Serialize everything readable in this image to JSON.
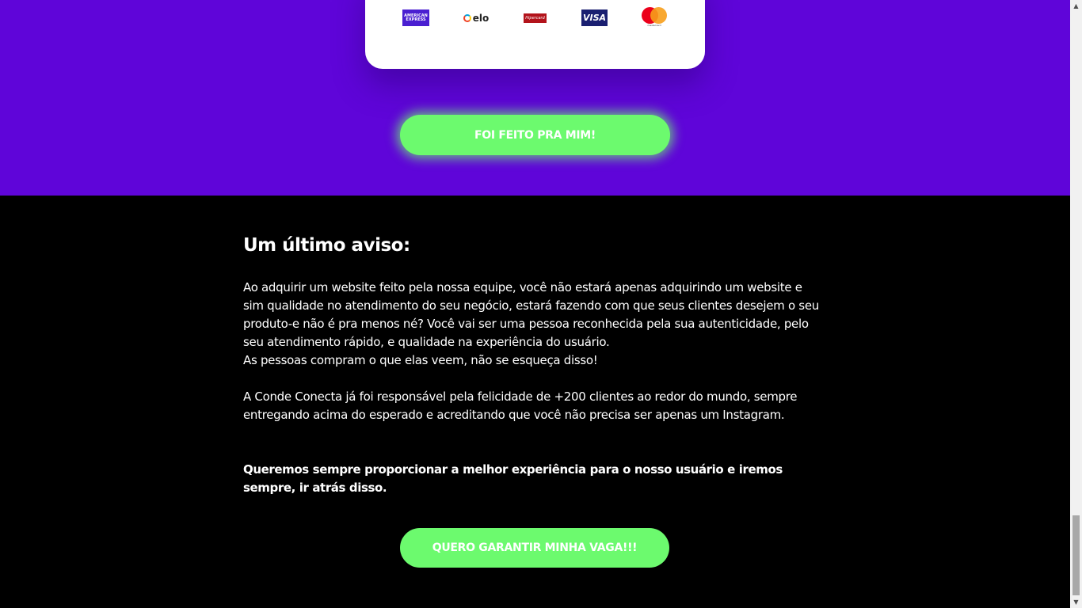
{
  "payment_card": {
    "brands": [
      {
        "name": "American Express",
        "text": "AMERICAN EXPRESS",
        "icon": "amex-icon",
        "color": "#4a1fd1"
      },
      {
        "name": "Elo",
        "text": "elo",
        "icon": "elo-icon"
      },
      {
        "name": "Hipercard",
        "text": "Hipercard",
        "icon": "hipercard-icon",
        "color": "#b3131b"
      },
      {
        "name": "Visa",
        "text": "VISA",
        "icon": "visa-icon",
        "color": "#1a1f71"
      },
      {
        "name": "Mastercard",
        "text": "mastercard",
        "icon": "mastercard-icon"
      }
    ]
  },
  "cta_top": {
    "label": "FOI FEITO PRA MIM!"
  },
  "notice": {
    "title": "Um último aviso:",
    "paragraph1": "Ao adquirir um website feito pela nossa equipe, você não estará apenas adquirindo um website e sim qualidade no atendimento do seu negócio, estará fazendo com que seus clientes desejem o seu produto-e não é pra menos né? Você vai ser uma pessoa reconhecida pela sua autenticidade, pelo seu atendimento rápido, e qualidade na experiência do usuário.",
    "paragraph2": "As pessoas compram o que elas veem, não se esqueça disso!",
    "paragraph3": "A Conde Conecta já foi responsável pela felicidade de +200 clientes ao redor do mundo, sempre entregando acima do esperado e acreditando que você não precisa ser apenas um Instagram.",
    "strong": "Queremos sempre proporcionar a melhor experiência para o nosso usuário e iremos sempre, ir atrás disso."
  },
  "cta_bottom": {
    "label": "QUERO GARANTIR MINHA VAGA!!!"
  },
  "colors": {
    "purple": "#5f05d9",
    "green": "#6cfa6e",
    "background": "#000000",
    "text": "#ffffff"
  },
  "scrollbar": {
    "icons": [
      "chevron-up-icon",
      "chevron-down-icon"
    ]
  }
}
